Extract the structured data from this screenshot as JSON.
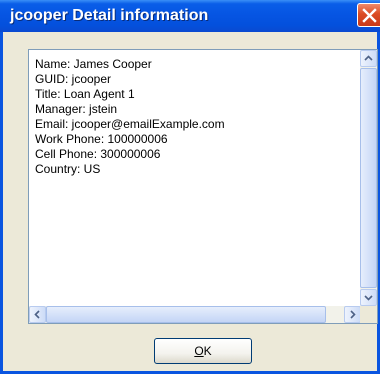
{
  "window": {
    "title": "jcooper Detail information"
  },
  "details": [
    "Name: James  Cooper",
    "GUID: jcooper",
    "Title: Loan Agent 1",
    "Manager: jstein",
    "Email: jcooper@emailExample.com",
    "Work Phone: 100000006",
    "Cell Phone: 300000006",
    "Country: US"
  ],
  "buttons": {
    "ok_label": "OK",
    "ok_mnemonic": "O",
    "ok_rest": "K"
  },
  "icons": {
    "close": "close-icon",
    "scroll_up": "arrow-up-icon",
    "scroll_down": "arrow-down-icon",
    "scroll_left": "arrow-left-icon",
    "scroll_right": "arrow-right-icon"
  }
}
